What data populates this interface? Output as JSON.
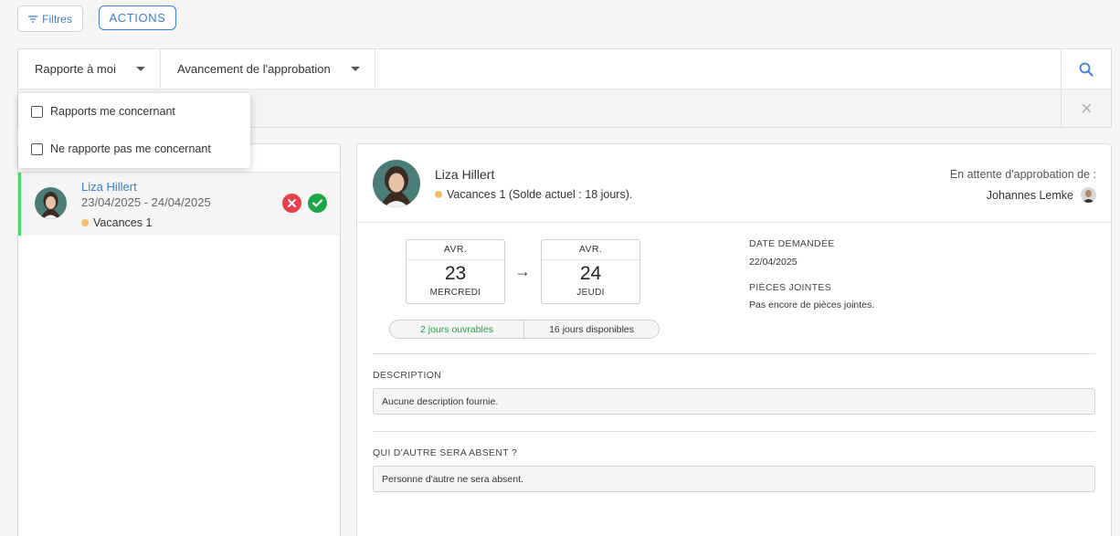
{
  "toolbar": {
    "filtres_label": "Filtres",
    "actions_label": "ACTIONS"
  },
  "filters": {
    "dropdown1_label": "Rapporte à moi",
    "dropdown2_label": "Avancement de l'approbation",
    "search_icon": "search-icon",
    "close_icon": "close-icon"
  },
  "popup": {
    "options": [
      {
        "label": "Rapports me concernant",
        "checked": false
      },
      {
        "label": "Ne rapporte pas me concernant",
        "checked": false
      }
    ]
  },
  "list": {
    "items": [
      {
        "name": "Liza Hillert",
        "dates": "23/04/2025 - 24/04/2025",
        "type": "Vacances 1",
        "type_color": "#f5c06a"
      }
    ]
  },
  "detail": {
    "name": "Liza Hillert",
    "type_line": "Vacances 1 (Solde actuel : 18 jours).",
    "awaiting_label": "En attente d'approbation de :",
    "approver": "Johannes Lemke",
    "start": {
      "month": "AVR.",
      "day": "23",
      "weekday": "MERCREDI"
    },
    "end": {
      "month": "AVR.",
      "day": "24",
      "weekday": "JEUDI"
    },
    "arrow": "→",
    "working_days": "2 jours ouvrables",
    "available_days": "16 jours disponibles",
    "date_requested_label": "DATE DEMANDÉE",
    "date_requested": "22/04/2025",
    "attachments_label": "PIÈCES JOINTES",
    "attachments_value": "Pas encore de pièces jointes.",
    "description_label": "DESCRIPTION",
    "description_value": "Aucune description fournie.",
    "absent_label": "QUI D'AUTRE SERA ABSENT ?",
    "absent_value": "Personne d'autre ne sera absent."
  },
  "colors": {
    "accent": "#3b7dd8",
    "approve": "#1aa647",
    "reject": "#e8414b",
    "active_marker": "#4cd964"
  }
}
